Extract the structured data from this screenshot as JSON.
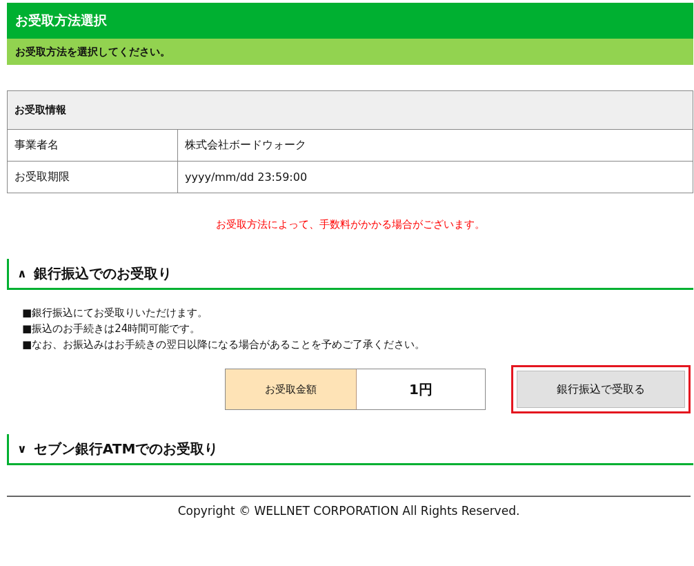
{
  "header": {
    "title": "お受取方法選択",
    "subtitle": "お受取方法を選択してください。"
  },
  "info_table": {
    "caption": "お受取情報",
    "rows": [
      {
        "label": "事業者名",
        "value": "株式会社ボードウォーク"
      },
      {
        "label": "お受取期限",
        "value": "yyyy/mm/dd 23:59:00"
      }
    ]
  },
  "notice": "お受取方法によって、手数料がかかる場合がございます。",
  "sections": [
    {
      "toggle": "∧",
      "title": "銀行振込でのお受取り",
      "expanded": true,
      "lines": [
        "■銀行振込にてお受取りいただけます。",
        "■振込のお手続きは24時間可能です。",
        "■なお、お振込みはお手続きの翌日以降になる場合があることを予めご了承ください。"
      ],
      "amount_label": "お受取金額",
      "amount": "1円",
      "button": {
        "label": "銀行振込で受取る",
        "highlighted": true
      }
    },
    {
      "toggle": "∨",
      "title": "セブン銀行ATMでのお受取り",
      "expanded": false
    }
  ],
  "footer": "Copyright © WELLNET CORPORATION All Rights Reserved."
}
